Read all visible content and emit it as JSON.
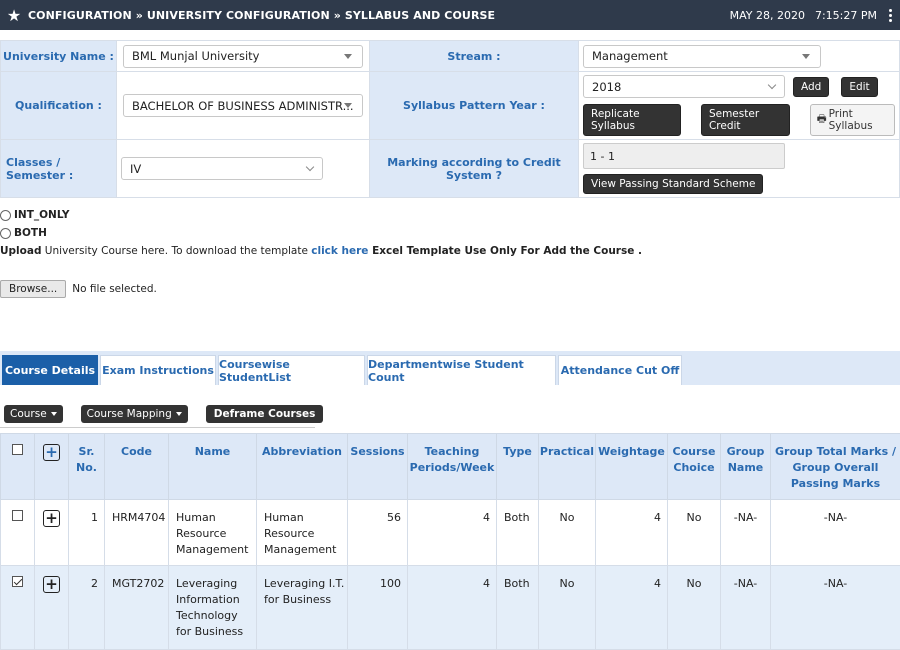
{
  "header": {
    "breadcrumb": "CONFIGURATION » UNIVERSITY CONFIGURATION » SYLLABUS AND COURSE",
    "date": "MAY 28, 2020",
    "time": "7:15:27 PM",
    "bg_color": "#2f3a4b"
  },
  "form": {
    "university_label": "University Name :",
    "university_value": "BML Munjal University",
    "stream_label": "Stream :",
    "stream_value": "Management",
    "qualification_label": "Qualification :",
    "qualification_value": "BACHELOR OF BUSINESS ADMINISTR...",
    "syllabus_year_label": "Syllabus Pattern Year :",
    "syllabus_year_value": "2018",
    "add_label": "Add",
    "edit_label": "Edit",
    "replicate_label": "Replicate Syllabus",
    "semester_credit_label": "Semester Credit",
    "print_label": "Print Syllabus",
    "classes_label": "Classes / Semester :",
    "classes_value": "IV",
    "marking_label": "Marking according to Credit System ?",
    "marking_value": "1 - 1",
    "view_passing_label": "View Passing Standard Scheme"
  },
  "options": {
    "int_only": "INT_ONLY",
    "both": "BOTH"
  },
  "upload": {
    "prefix": "Upload",
    "text": " University Course here. To download the template ",
    "link": "click here",
    "suffix": " Excel Template Use Only For Add the Course .",
    "browse": "Browse...",
    "no_file": "No file selected."
  },
  "tabs": [
    "Course Details",
    "Exam Instructions",
    "Coursewise StudentList",
    "Departmentwise Student Count",
    "Attendance Cut Off"
  ],
  "toolbar": {
    "course": "Course",
    "course_mapping": "Course Mapping",
    "deframe": "Deframe Courses"
  },
  "table": {
    "headers": {
      "sr": "Sr. No.",
      "code": "Code",
      "name": "Name",
      "abbr": "Abbreviation",
      "sessions": "Sessions",
      "teaching": "Teaching Periods/Week",
      "type": "Type",
      "practical": "Practical",
      "weightage": "Weightage",
      "choice": "Course Choice",
      "group": "Group Name",
      "group_total": "Group Total Marks / Group Overall Passing Marks"
    },
    "rows": [
      {
        "checked": false,
        "sr": "1",
        "code": "HRM4704",
        "name": "Human Resource Management",
        "abbr": "Human Resource Management",
        "sessions": "56",
        "teaching": "4",
        "type": "Both",
        "practical": "No",
        "weightage": "4",
        "choice": "No",
        "group": "-NA-",
        "group_total": "-NA-"
      },
      {
        "checked": true,
        "sr": "2",
        "code": "MGT2702",
        "name": "Leveraging Information Technology for Business",
        "abbr": "Leveraging I.T. for Business",
        "sessions": "100",
        "teaching": "4",
        "type": "Both",
        "practical": "No",
        "weightage": "4",
        "choice": "No",
        "group": "-NA-",
        "group_total": "-NA-"
      }
    ]
  },
  "colors": {
    "accent": "#2a6ab0",
    "active_tab": "#1b5fa8",
    "label_bg": "#dde8f7"
  }
}
